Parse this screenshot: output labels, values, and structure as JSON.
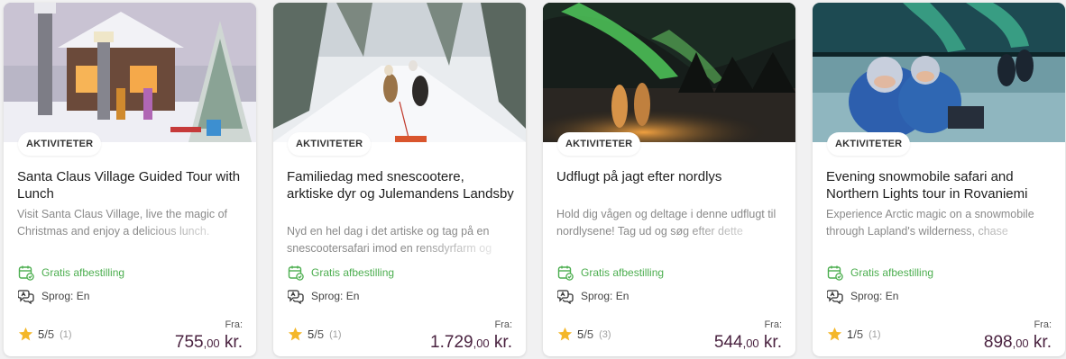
{
  "cards": [
    {
      "badge": "AKTIVITETER",
      "title": "Santa Claus Village Guided Tour with Lunch",
      "description": "Visit Santa Claus Village, live the magic of Christmas and enjoy a delicious lunch.",
      "cancellation": "Gratis afbestilling",
      "language": "Sprog: En",
      "rating": "5",
      "rating_max": "/5",
      "review_count": "(1)",
      "price_prefix": "Fra:",
      "price_int": "755",
      "price_dec": ",00",
      "currency": " kr."
    },
    {
      "badge": "AKTIVITETER",
      "title": "Familiedag med snescootere, arktiske dyr og Julemandens Landsby",
      "description": "Nyd en hel dag i det artiske og tag på en snescootersafari imod en rensdyrfarm og",
      "cancellation": "Gratis afbestilling",
      "language": "Sprog: En",
      "rating": "5",
      "rating_max": "/5",
      "review_count": "(1)",
      "price_prefix": "Fra:",
      "price_int": "1.729",
      "price_dec": ",00",
      "currency": " kr."
    },
    {
      "badge": "AKTIVITETER",
      "title": "Udflugt på jagt efter nordlys",
      "description": "Hold dig vågen og deltage i denne udflugt til nordlysene! Tag ud og søg efter dette",
      "cancellation": "Gratis afbestilling",
      "language": "Sprog: En",
      "rating": "5",
      "rating_max": "/5",
      "review_count": "(3)",
      "price_prefix": "Fra:",
      "price_int": "544",
      "price_dec": ",00",
      "currency": " kr."
    },
    {
      "badge": "AKTIVITETER",
      "title": "Evening snowmobile safari and Northern Lights tour in Rovaniemi",
      "description": "Experience Arctic magic on a snowmobile through Lapland's wilderness, chase",
      "cancellation": "Gratis afbestilling",
      "language": "Sprog: En",
      "rating": "1",
      "rating_max": "/5",
      "review_count": "(1)",
      "price_prefix": "Fra:",
      "price_int": "898",
      "price_dec": ",00",
      "currency": " kr."
    }
  ],
  "colors": {
    "cancel_green": "#4cae4f",
    "price_purple": "#4a2340",
    "star_gold": "#f4b728"
  },
  "icons": {
    "cancellation": "calendar-check-icon",
    "language": "speech-bubbles-icon",
    "rating": "star-icon"
  }
}
